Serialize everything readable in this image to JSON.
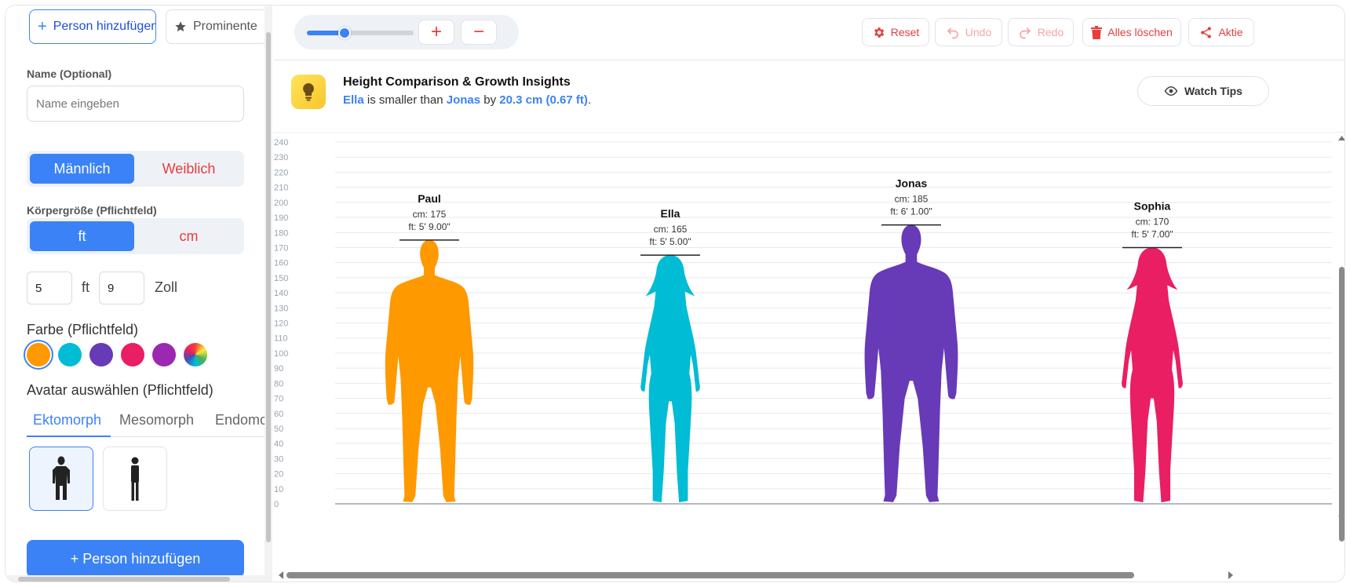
{
  "sidebar": {
    "add_person_tab": "Person hinzufügen",
    "celebrities_tab": "Prominente",
    "name_label": "Name (Optional)",
    "name_placeholder": "Name eingeben",
    "gender": {
      "male": "Männlich",
      "female": "Weiblich",
      "selected": "Männlich"
    },
    "height_label": "Körpergröße (Pflichtfeld)",
    "unit": {
      "ft": "ft",
      "cm": "cm",
      "selected": "ft"
    },
    "feet_value": "5",
    "feet_unit": "ft",
    "inch_value": "9",
    "inch_unit": "Zoll",
    "color_label": "Farbe (Pflichtfeld)",
    "colors": [
      "#ff9900",
      "#00bcd4",
      "#673ab7",
      "#e91e63",
      "#9c27b0"
    ],
    "selected_color": "#ff9900",
    "avatar_label": "Avatar auswählen (Pflichtfeld)",
    "avatar_tabs": [
      "Ektomorph",
      "Mesomorph",
      "Endomo"
    ],
    "avatar_tab_active": "Ektomorph",
    "submit_label": "+ Person hinzufügen"
  },
  "toolbar": {
    "zoom_level": 0.35,
    "plus": "+",
    "minus": "−",
    "reset": "Reset",
    "undo": "Undo",
    "redo": "Redo",
    "clear_all": "Alles löschen",
    "share": "Aktie"
  },
  "insight": {
    "title": "Height Comparison & Growth Insights",
    "name_a": "Ella",
    "text_mid": " is smaller than ",
    "name_b": "Jonas",
    "text_by": " by ",
    "difference": "20.3 cm (0.67 ft)",
    "text_end": ".",
    "watch_tips": "Watch Tips"
  },
  "chart_data": {
    "type": "height-comparison",
    "y_unit": "cm",
    "ylim": [
      0,
      240
    ],
    "y_ticks": [
      0,
      10,
      20,
      30,
      40,
      50,
      60,
      70,
      80,
      90,
      100,
      110,
      120,
      130,
      140,
      150,
      160,
      170,
      180,
      190,
      200,
      210,
      220,
      230,
      240
    ],
    "persons": [
      {
        "name": "Paul",
        "cm": 175,
        "cm_label": "cm: 175",
        "ft_label": "ft: 5' 9.00\"",
        "color": "#ff9900",
        "gender": "male"
      },
      {
        "name": "Ella",
        "cm": 165,
        "cm_label": "cm: 165",
        "ft_label": "ft: 5' 5.00\"",
        "color": "#00bcd4",
        "gender": "female"
      },
      {
        "name": "Jonas",
        "cm": 185,
        "cm_label": "cm: 185",
        "ft_label": "ft: 6' 1.00\"",
        "color": "#673ab7",
        "gender": "male"
      },
      {
        "name": "Sophia",
        "cm": 170,
        "cm_label": "cm: 170",
        "ft_label": "ft: 5' 7.00\"",
        "color": "#e91e63",
        "gender": "female"
      }
    ]
  }
}
